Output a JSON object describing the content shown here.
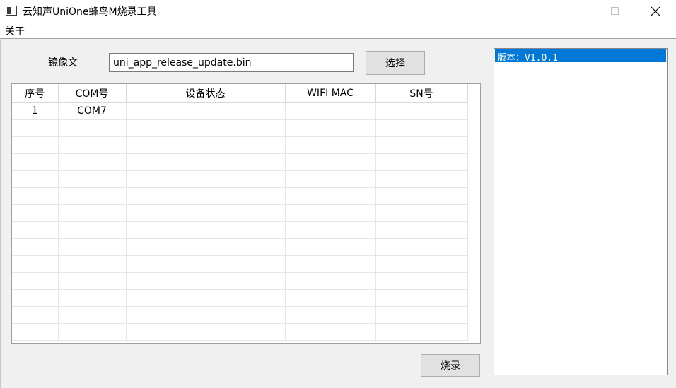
{
  "window": {
    "title": "云知声UniOne蜂鸟M烧录工具"
  },
  "menu": {
    "items": [
      {
        "label": "关于"
      }
    ]
  },
  "file": {
    "label": "镜像文",
    "value": "uni_app_release_update.bin"
  },
  "buttons": {
    "select_label": "选择",
    "burn_label": "烧录"
  },
  "table": {
    "headers": [
      "序号",
      "COM号",
      "设备状态",
      "WIFI MAC",
      "SN号"
    ],
    "rows": [
      [
        "1",
        "COM7",
        "",
        "",
        ""
      ],
      [
        "",
        "",
        "",
        "",
        ""
      ],
      [
        "",
        "",
        "",
        "",
        ""
      ],
      [
        "",
        "",
        "",
        "",
        ""
      ],
      [
        "",
        "",
        "",
        "",
        ""
      ],
      [
        "",
        "",
        "",
        "",
        ""
      ],
      [
        "",
        "",
        "",
        "",
        ""
      ],
      [
        "",
        "",
        "",
        "",
        ""
      ],
      [
        "",
        "",
        "",
        "",
        ""
      ],
      [
        "",
        "",
        "",
        "",
        ""
      ],
      [
        "",
        "",
        "",
        "",
        ""
      ],
      [
        "",
        "",
        "",
        "",
        ""
      ],
      [
        "",
        "",
        "",
        "",
        ""
      ],
      [
        "",
        "",
        "",
        "",
        ""
      ]
    ]
  },
  "log": {
    "lines": [
      "版本：V1.0.1"
    ]
  },
  "colors": {
    "selection": "#0078d7",
    "button_face": "#e1e1e1",
    "window_bg": "#f0f0f0"
  },
  "icons": {
    "app": "app-window-icon",
    "minimize": "minimize-icon",
    "maximize": "maximize-icon",
    "close": "close-icon"
  }
}
